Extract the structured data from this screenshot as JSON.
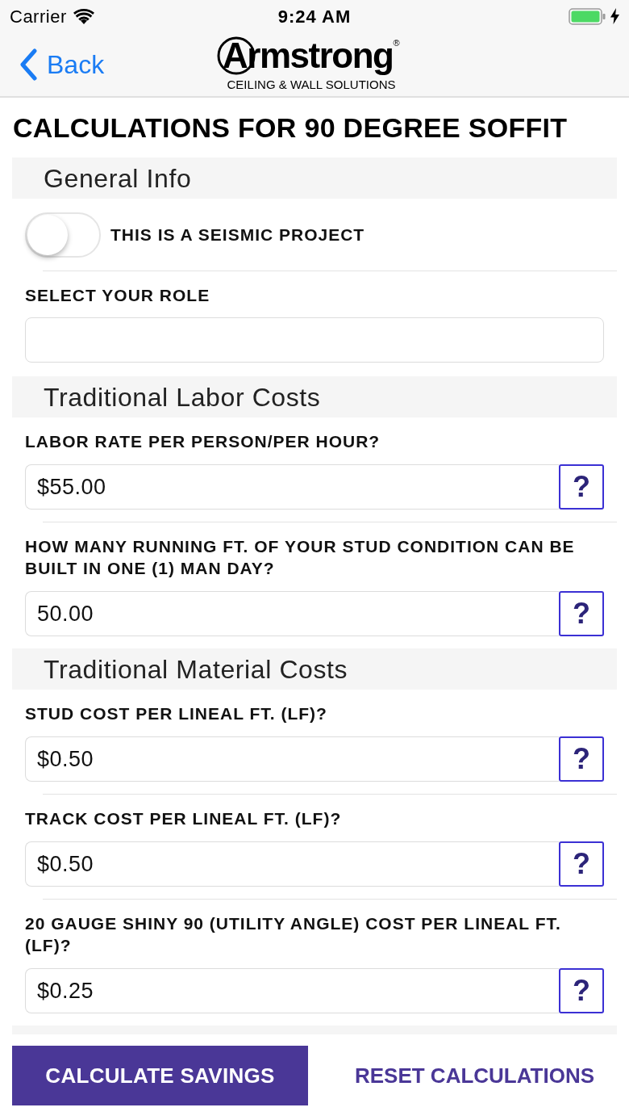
{
  "status_bar": {
    "carrier": "Carrier",
    "time": "9:24 AM"
  },
  "nav_bar": {
    "back": "Back",
    "logo": {
      "name": "Armstrong$^{®}$",
      "tagline": "CEILING & WALL SOLUTIONS"
    }
  },
  "title": "CALCULATIONS FOR 90 DEGREE SOFFIT",
  "sections": [
    {
      "header": "General Info",
      "items": [
        {
          "kind": "toggle",
          "label": "THIS IS A SEISMIC PROJECT",
          "on": false
        },
        {
          "kind": "select",
          "label": "SELECT YOUR ROLE"
        }
      ]
    },
    {
      "header": "Traditional Labor Costs",
      "items": [
        {
          "kind": "input",
          "label": "LABOR RATE PER PERSON/PER HOUR?",
          "value": "$55.00",
          "help": "?"
        },
        {
          "kind": "input",
          "label": "HOW MANY RUNNING FT. OF YOUR STUD CONDITION CAN BE BUILT IN ONE (1) MAN DAY?",
          "value": "50.00",
          "help": "?"
        }
      ]
    },
    {
      "header": "Traditional Material Costs",
      "items": [
        {
          "kind": "input",
          "label": "STUD COST PER LINEAL FT. (LF)?",
          "value": "$0.50",
          "help": "?"
        },
        {
          "kind": "input",
          "label": "TRACK COST PER LINEAL FT. (LF)?",
          "value": "$0.50",
          "help": "?"
        },
        {
          "kind": "input",
          "label": "20 GAUGE SHINY 90 (UTILITY ANGLE) COST PER LINEAL FT. (LF)?",
          "value": "$0.25",
          "help": "?"
        }
      ]
    }
  ],
  "buttons": [
    {
      "kind": "primary",
      "label": "CALCULATE SAVINGS"
    },
    {
      "kind": "link",
      "label": "RESET CALCULATIONS"
    }
  ]
}
